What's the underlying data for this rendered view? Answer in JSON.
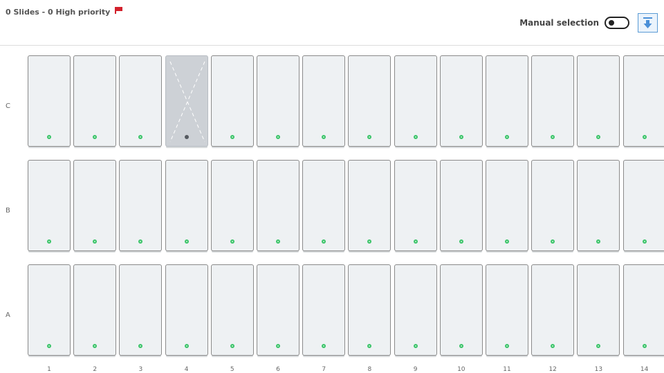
{
  "header": {
    "summary_text": "0 Slides - 0 High priority",
    "manual_selection_label": "Manual selection",
    "manual_selection_on": false,
    "flag_color": "#d3212c",
    "accent_color": "#5b9bd5"
  },
  "grid": {
    "rows": [
      "C",
      "B",
      "A"
    ],
    "columns": [
      "1",
      "2",
      "3",
      "4",
      "5",
      "6",
      "7",
      "8",
      "9",
      "10",
      "11",
      "12",
      "13",
      "14"
    ],
    "empty_slots": [
      {
        "row": "C",
        "column": "4"
      }
    ],
    "ok_status_color": "#3cc46a"
  }
}
